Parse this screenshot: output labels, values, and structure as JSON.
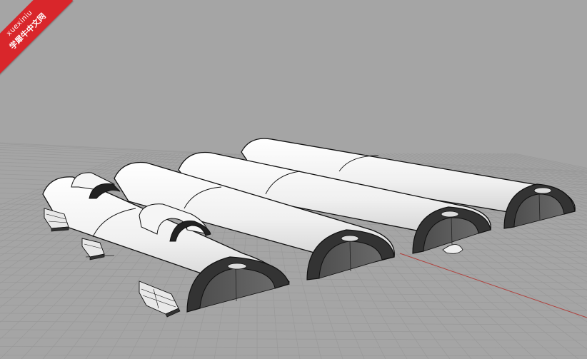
{
  "viewport": {
    "background_color": "#a5a5a5",
    "grid_color": "#9a9a9a",
    "grid_major_color": "#8e8e8e",
    "x_axis_color": "#b0403c",
    "y_axis_color": "#4a7a46",
    "shade_color": "#5a5a5a",
    "surface_color": "#ffffff",
    "edge_color": "#111111"
  },
  "watermark": {
    "line1": "xuexiniu",
    "line2": "学犀牛中文网",
    "color": "#d9262b"
  }
}
